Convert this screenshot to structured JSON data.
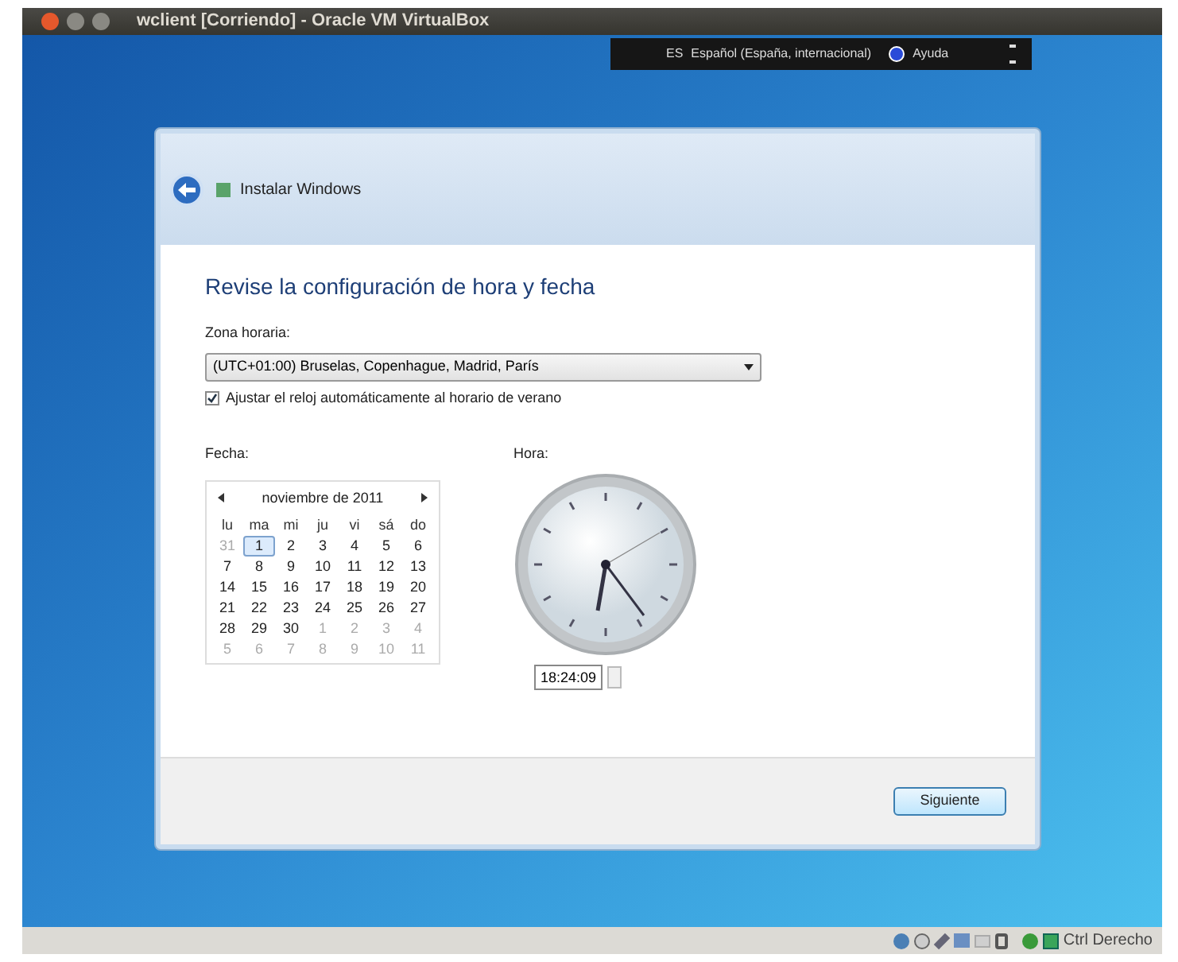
{
  "window": {
    "title": "wclient [Corriendo] - Oracle VM VirtualBox"
  },
  "language_bar": {
    "code": "ES",
    "language": "Español (España, internacional)",
    "help": "Ayuda"
  },
  "dialog": {
    "title": "Instalar Windows",
    "heading": "Revise la configuración de hora y fecha",
    "timezone": {
      "label": "Zona horaria:",
      "value": "(UTC+01:00) Bruselas, Copenhague, Madrid, París"
    },
    "dst_checkbox": {
      "label": "Ajustar el reloj automáticamente al horario de verano",
      "checked": true
    },
    "date": {
      "label": "Fecha:",
      "month": "noviembre de 2011",
      "weekdays": [
        "lu",
        "ma",
        "mi",
        "ju",
        "vi",
        "sá",
        "do"
      ],
      "weeks": [
        [
          {
            "day": "31",
            "muted": true,
            "selected": false
          },
          {
            "day": "1",
            "muted": false,
            "selected": true
          },
          {
            "day": "2",
            "muted": false,
            "selected": false
          },
          {
            "day": "3",
            "muted": false,
            "selected": false
          },
          {
            "day": "4",
            "muted": false,
            "selected": false
          },
          {
            "day": "5",
            "muted": false,
            "selected": false
          },
          {
            "day": "6",
            "muted": false,
            "selected": false
          }
        ],
        [
          {
            "day": "7",
            "muted": false,
            "selected": false
          },
          {
            "day": "8",
            "muted": false,
            "selected": false
          },
          {
            "day": "9",
            "muted": false,
            "selected": false
          },
          {
            "day": "10",
            "muted": false,
            "selected": false
          },
          {
            "day": "11",
            "muted": false,
            "selected": false
          },
          {
            "day": "12",
            "muted": false,
            "selected": false
          },
          {
            "day": "13",
            "muted": false,
            "selected": false
          }
        ],
        [
          {
            "day": "14",
            "muted": false,
            "selected": false
          },
          {
            "day": "15",
            "muted": false,
            "selected": false
          },
          {
            "day": "16",
            "muted": false,
            "selected": false
          },
          {
            "day": "17",
            "muted": false,
            "selected": false
          },
          {
            "day": "18",
            "muted": false,
            "selected": false
          },
          {
            "day": "19",
            "muted": false,
            "selected": false
          },
          {
            "day": "20",
            "muted": false,
            "selected": false
          }
        ],
        [
          {
            "day": "21",
            "muted": false,
            "selected": false
          },
          {
            "day": "22",
            "muted": false,
            "selected": false
          },
          {
            "day": "23",
            "muted": false,
            "selected": false
          },
          {
            "day": "24",
            "muted": false,
            "selected": false
          },
          {
            "day": "25",
            "muted": false,
            "selected": false
          },
          {
            "day": "26",
            "muted": false,
            "selected": false
          },
          {
            "day": "27",
            "muted": false,
            "selected": false
          }
        ],
        [
          {
            "day": "28",
            "muted": false,
            "selected": false
          },
          {
            "day": "29",
            "muted": false,
            "selected": false
          },
          {
            "day": "30",
            "muted": false,
            "selected": false
          },
          {
            "day": "1",
            "muted": true,
            "selected": false
          },
          {
            "day": "2",
            "muted": true,
            "selected": false
          },
          {
            "day": "3",
            "muted": true,
            "selected": false
          },
          {
            "day": "4",
            "muted": true,
            "selected": false
          }
        ],
        [
          {
            "day": "5",
            "muted": true,
            "selected": false
          },
          {
            "day": "6",
            "muted": true,
            "selected": false
          },
          {
            "day": "7",
            "muted": true,
            "selected": false
          },
          {
            "day": "8",
            "muted": true,
            "selected": false
          },
          {
            "day": "9",
            "muted": true,
            "selected": false
          },
          {
            "day": "10",
            "muted": true,
            "selected": false
          },
          {
            "day": "11",
            "muted": true,
            "selected": false
          }
        ]
      ]
    },
    "time": {
      "label": "Hora:",
      "value": "18:24:09"
    },
    "next_button": "Siguiente"
  },
  "status_bar": {
    "host_key": "Ctrl Derecho"
  }
}
